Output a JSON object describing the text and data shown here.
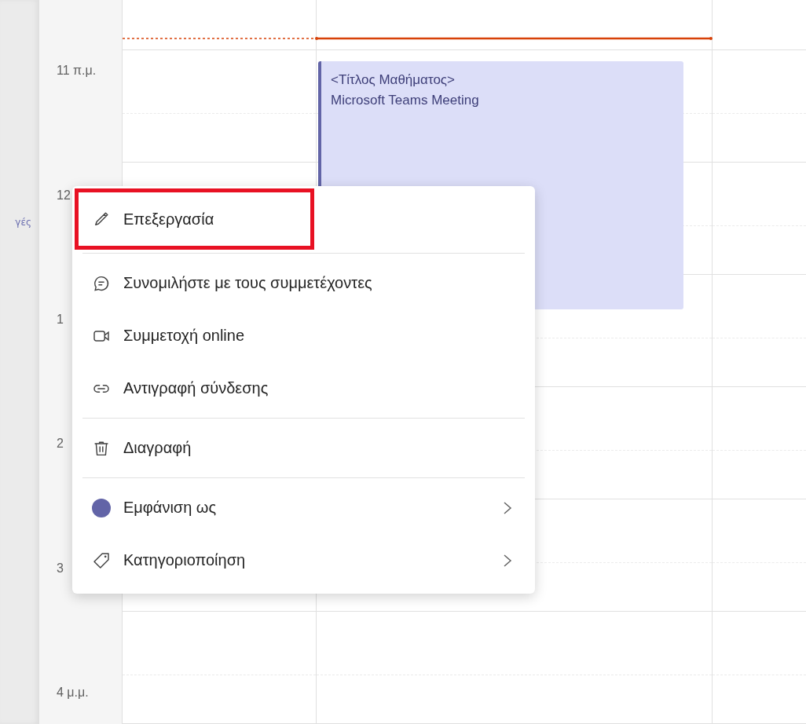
{
  "sidebar": {
    "label": "γές"
  },
  "calendar": {
    "hours": [
      {
        "label": "11 π.μ."
      },
      {
        "label": "12"
      },
      {
        "label": "1"
      },
      {
        "label": "2"
      },
      {
        "label": "3"
      },
      {
        "label": "4 μ.μ."
      }
    ],
    "event": {
      "title": "<Τίτλος Μαθήματος>",
      "subtitle": "Microsoft Teams Meeting",
      "color": "#6264a7"
    }
  },
  "context_menu": {
    "sections": [
      [
        {
          "label": "Επεξεργασία",
          "highlighted": true,
          "submenu": false
        }
      ],
      [
        {
          "label": "Συνομιλήστε με τους συμμετέχοντες",
          "highlighted": false,
          "submenu": false
        },
        {
          "label": "Συμμετοχή online",
          "highlighted": false,
          "submenu": false
        },
        {
          "label": "Αντιγραφή σύνδεσης",
          "highlighted": false,
          "submenu": false
        }
      ],
      [
        {
          "label": "Διαγραφή",
          "highlighted": false,
          "submenu": false
        }
      ],
      [
        {
          "label": "Εμφάνιση ως",
          "highlighted": false,
          "submenu": true,
          "color": "#6264a7"
        },
        {
          "label": "Κατηγοριοποίηση",
          "highlighted": false,
          "submenu": true
        }
      ]
    ]
  }
}
